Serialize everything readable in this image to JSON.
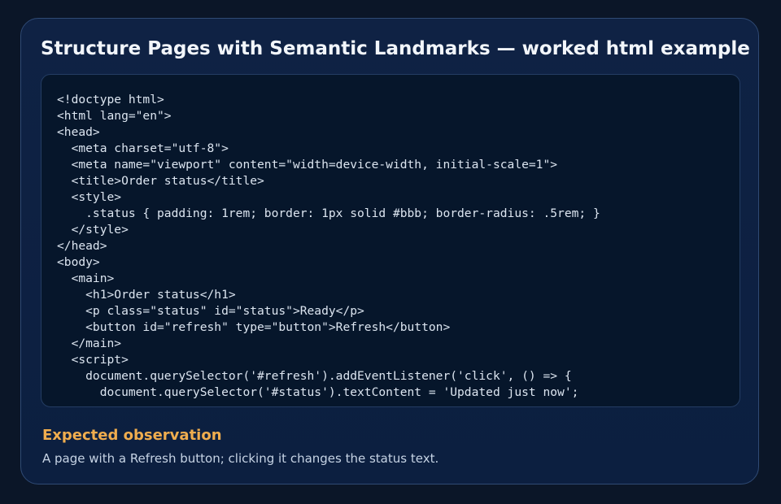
{
  "card": {
    "title": "Structure Pages with Semantic Landmarks — worked html example",
    "code_lines": [
      "<!doctype html>",
      "<html lang=\"en\">",
      "<head>",
      "  <meta charset=\"utf-8\">",
      "  <meta name=\"viewport\" content=\"width=device-width, initial-scale=1\">",
      "  <title>Order status</title>",
      "  <style>",
      "    .status { padding: 1rem; border: 1px solid #bbb; border-radius: .5rem; }",
      "  </style>",
      "</head>",
      "<body>",
      "  <main>",
      "    <h1>Order status</h1>",
      "    <p class=\"status\" id=\"status\">Ready</p>",
      "    <button id=\"refresh\" type=\"button\">Refresh</button>",
      "  </main>",
      "  <script>",
      "    document.querySelector('#refresh').addEventListener('click', () => {",
      "      document.querySelector('#status').textContent = 'Updated just now';"
    ],
    "observation_heading": "Expected observation",
    "observation_text": "A page with a Refresh button; clicking it changes the status text."
  },
  "colors": {
    "page_background": "#0b1628",
    "card_background": "#0f2244",
    "code_background": "#06162b",
    "heading_accent": "#f0ad4e",
    "title_text": "#f2f6fb"
  }
}
